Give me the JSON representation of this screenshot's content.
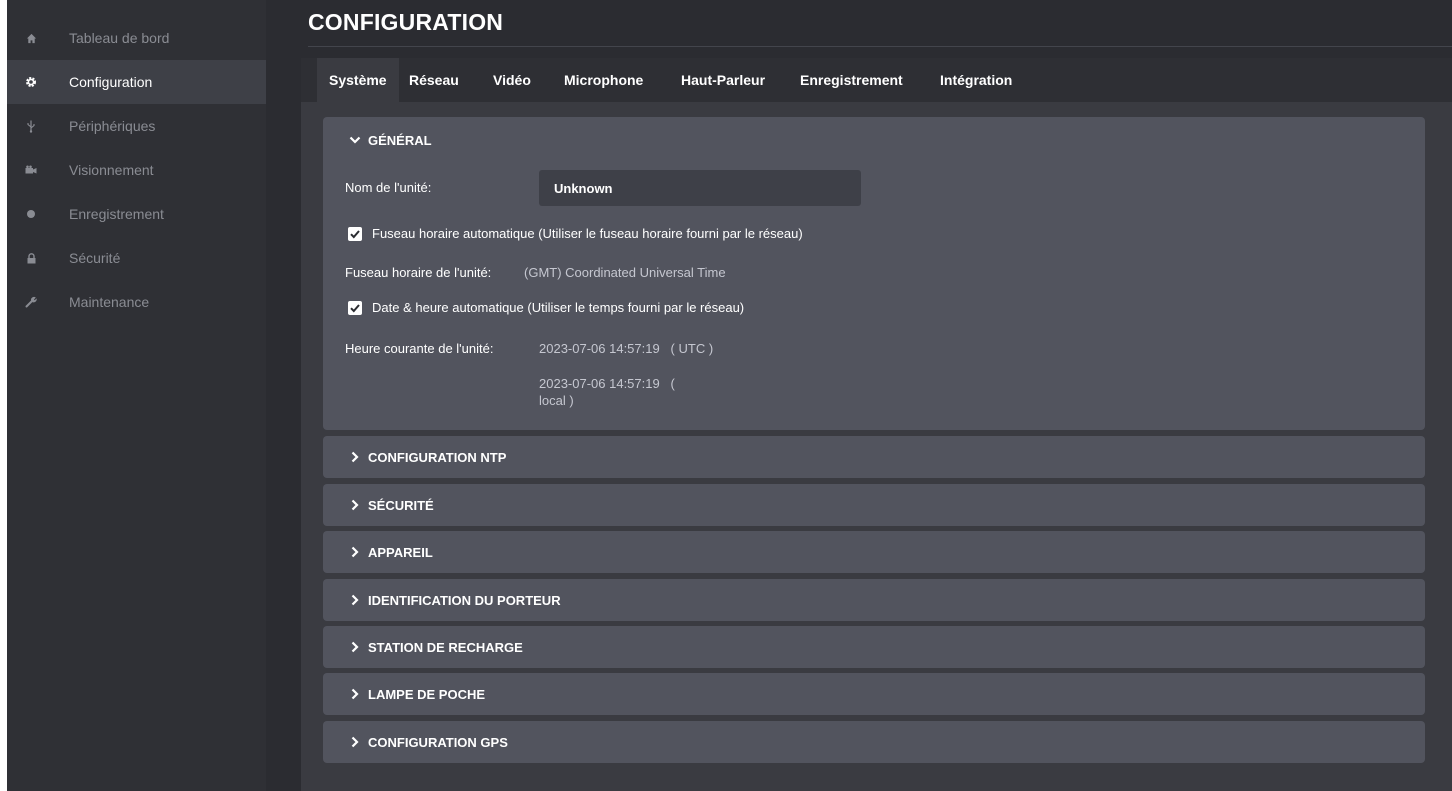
{
  "sidebar": {
    "items": [
      {
        "label": "Tableau de bord",
        "icon": "home-icon"
      },
      {
        "label": "Configuration",
        "icon": "gear-icon",
        "active": true
      },
      {
        "label": "Périphériques",
        "icon": "usb-icon"
      },
      {
        "label": "Visionnement",
        "icon": "camera-icon"
      },
      {
        "label": "Enregistrement",
        "icon": "record-icon"
      },
      {
        "label": "Sécurité",
        "icon": "lock-icon"
      },
      {
        "label": "Maintenance",
        "icon": "wrench-icon"
      }
    ]
  },
  "page": {
    "title": "CONFIGURATION"
  },
  "tabs": [
    {
      "label": "Système",
      "active": true
    },
    {
      "label": "Réseau"
    },
    {
      "label": "Vidéo"
    },
    {
      "label": "Microphone"
    },
    {
      "label": "Haut-Parleur"
    },
    {
      "label": "Enregistrement"
    },
    {
      "label": "Intégration"
    }
  ],
  "general": {
    "title": "GÉNÉRAL",
    "unit_name_label": "Nom de l'unité:",
    "unit_name_value": "Unknown",
    "auto_tz_label": "Fuseau horaire automatique (Utiliser le fuseau horaire fourni par le réseau)",
    "auto_tz_checked": true,
    "tz_label": "Fuseau horaire de l'unité:",
    "tz_value": "(GMT) Coordinated Universal Time",
    "auto_datetime_label": "Date & heure automatique (Utiliser le temps fourni par le réseau)",
    "auto_datetime_checked": true,
    "current_time_label": "Heure courante de l'unité:",
    "current_time_utc": "2023-07-06 14:57:19   ( UTC )",
    "current_time_local_1": "2023-07-06 14:57:19   (",
    "current_time_local_2": "local )"
  },
  "sections": [
    {
      "title": "CONFIGURATION NTP"
    },
    {
      "title": "SÉCURITÉ"
    },
    {
      "title": "APPAREIL"
    },
    {
      "title": "IDENTIFICATION DU PORTEUR"
    },
    {
      "title": "STATION DE RECHARGE"
    },
    {
      "title": "LAMPE DE POCHE"
    },
    {
      "title": "CONFIGURATION GPS"
    }
  ],
  "colors": {
    "sidebar_bg": "#2f3035",
    "sidebar_active": "#3e4047",
    "panel_bg": "#52545e",
    "content_bg": "#3a3b41"
  }
}
